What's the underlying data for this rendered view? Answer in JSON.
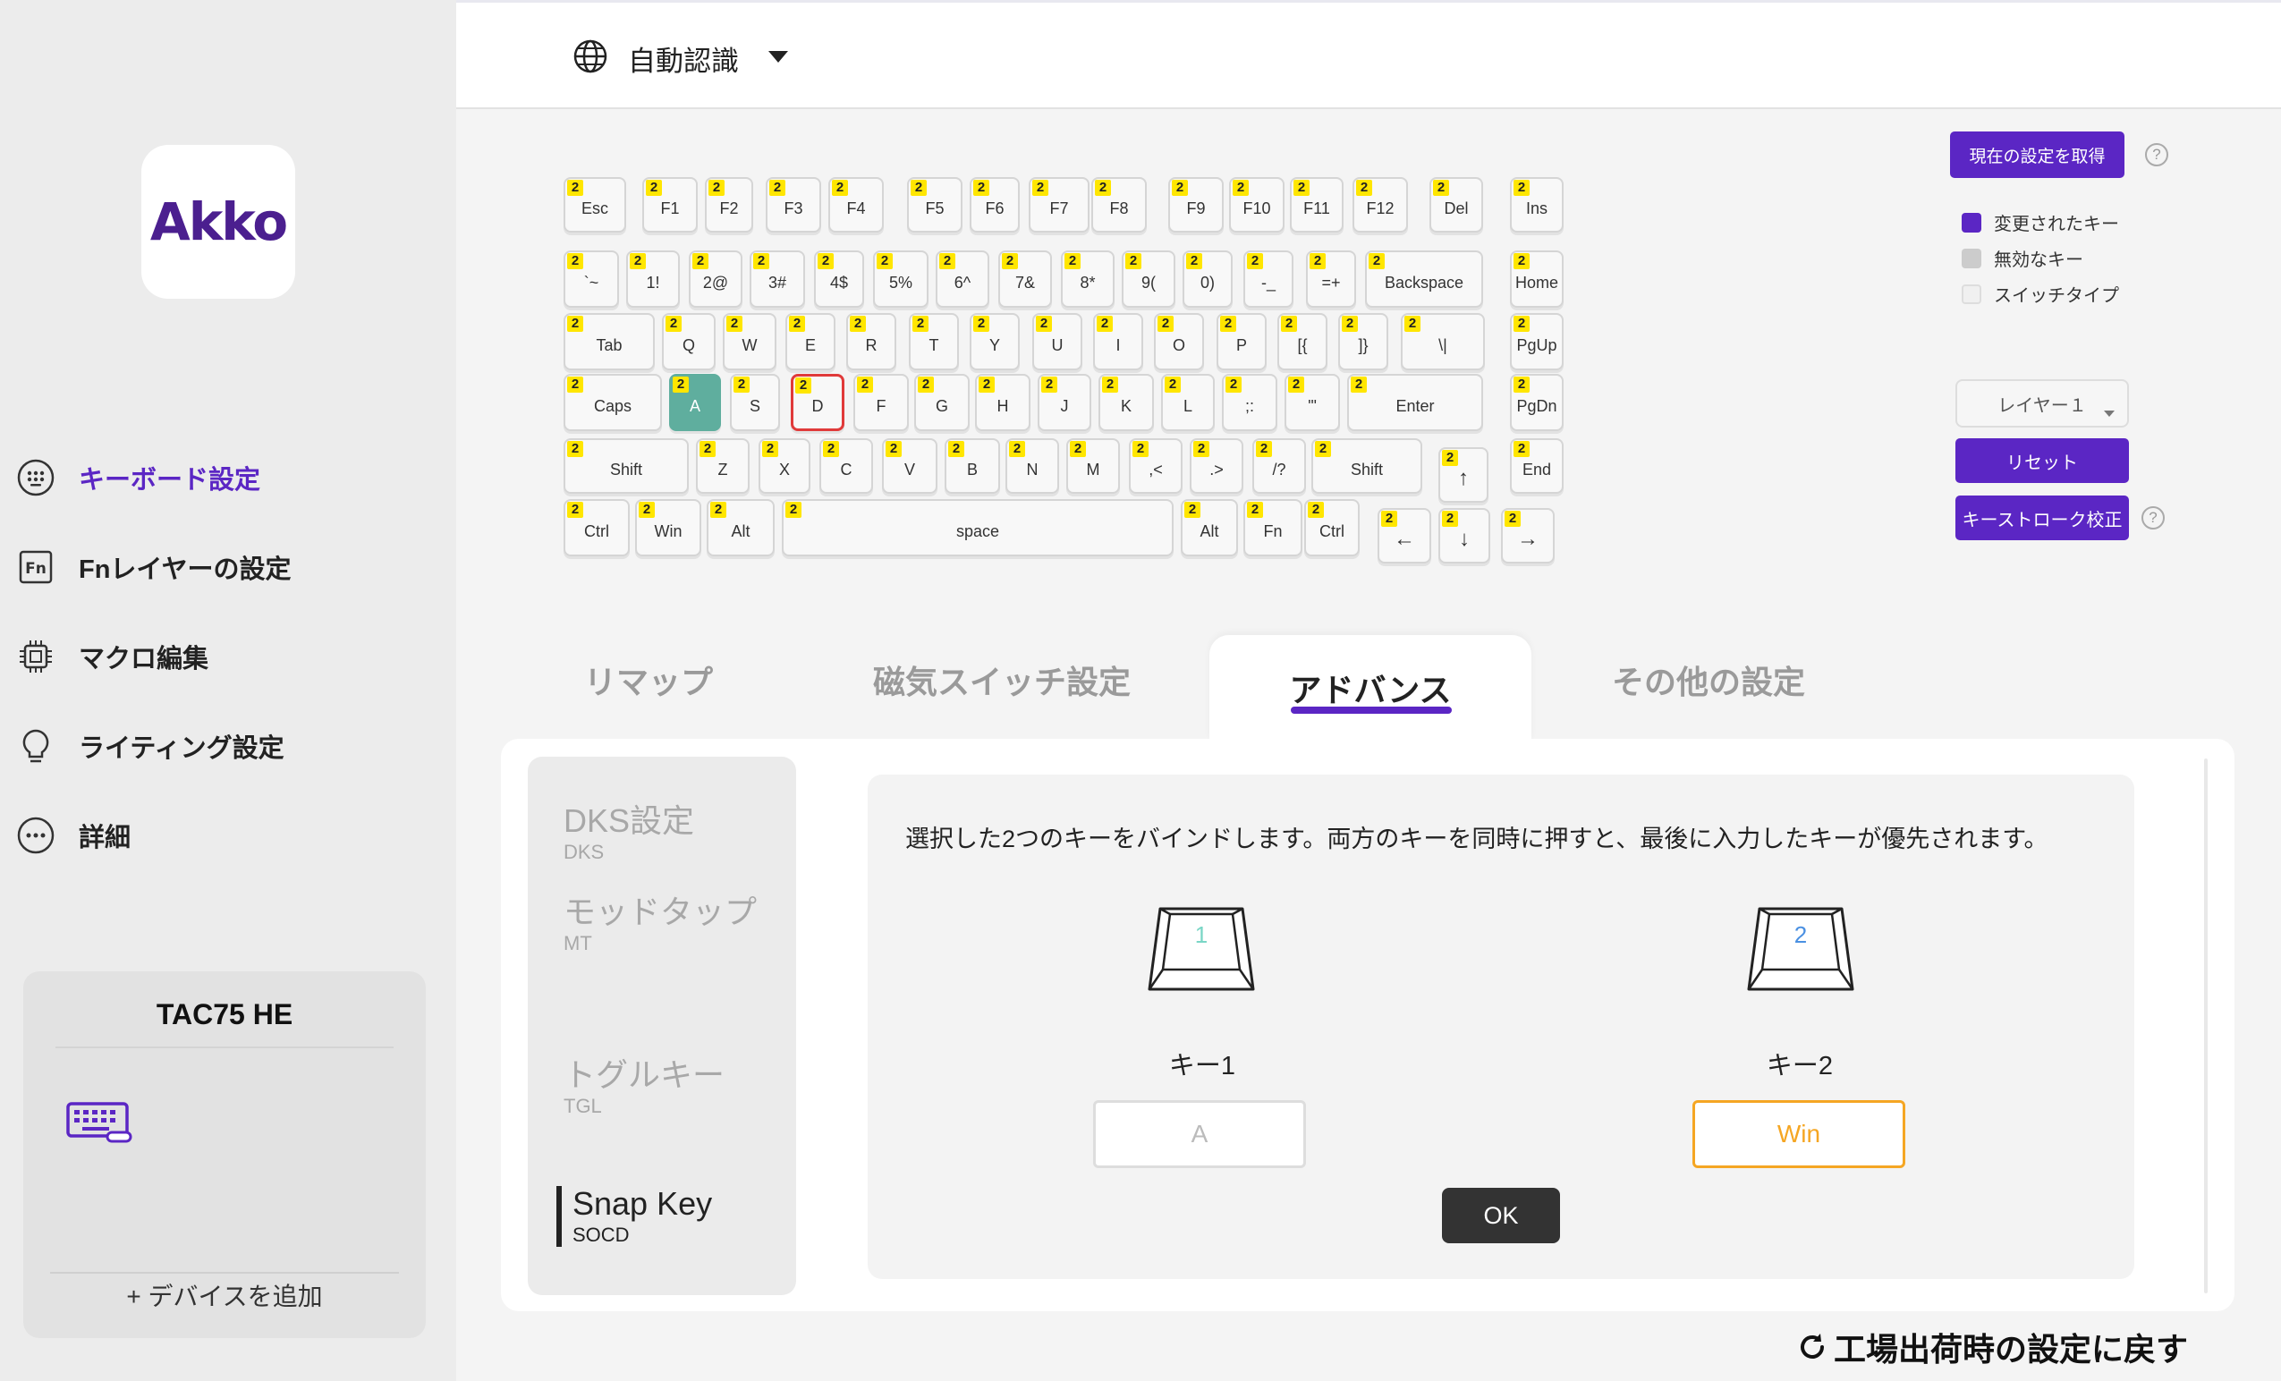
{
  "header": {
    "language_label": "自動認識"
  },
  "sidebar": {
    "logo_text": "Akko",
    "nav": [
      {
        "label": "キーボード設定",
        "icon": "keypad-icon",
        "active": true
      },
      {
        "label": "Fnレイヤーの設定",
        "icon": "fn-icon",
        "active": false
      },
      {
        "label": "マクロ編集",
        "icon": "chip-icon",
        "active": false
      },
      {
        "label": "ライティング設定",
        "icon": "bulb-icon",
        "active": false
      },
      {
        "label": "詳細",
        "icon": "more-icon",
        "active": false
      }
    ],
    "device": {
      "name": "TAC75 HE",
      "add_label": "+ デバイスを追加"
    }
  },
  "keyboard": {
    "badge": "2",
    "rows": [
      [
        [
          "Esc",
          "esc"
        ],
        [
          "F1",
          "f1"
        ],
        [
          "F2",
          "f2"
        ],
        [
          "F3",
          "f3"
        ],
        [
          "F4",
          "f4"
        ],
        [
          "F5",
          "f5"
        ],
        [
          "F6",
          "f6"
        ],
        [
          "F7",
          "f7"
        ],
        [
          "F8",
          "f8"
        ],
        [
          "F9",
          "f9"
        ],
        [
          "F10",
          "f10"
        ],
        [
          "F11",
          "f11"
        ],
        [
          "F12",
          "f12"
        ],
        [
          "Del",
          "del"
        ],
        [
          "Ins",
          "ins"
        ]
      ],
      [
        [
          "`~",
          "backtick"
        ],
        [
          "1!",
          "1"
        ],
        [
          "2@",
          "2"
        ],
        [
          "3#",
          "3"
        ],
        [
          "4$",
          "4"
        ],
        [
          "5%",
          "5"
        ],
        [
          "6^",
          "6"
        ],
        [
          "7&",
          "7"
        ],
        [
          "8*",
          "8"
        ],
        [
          "9(",
          "9"
        ],
        [
          "0)",
          "0"
        ],
        [
          "-_",
          "minus"
        ],
        [
          "=+",
          "equal"
        ],
        [
          "Backspace",
          "backspace"
        ],
        [
          "Home",
          "home"
        ]
      ],
      [
        [
          "Tab",
          "tab"
        ],
        [
          "Q",
          "q"
        ],
        [
          "W",
          "w"
        ],
        [
          "E",
          "e"
        ],
        [
          "R",
          "r"
        ],
        [
          "T",
          "t"
        ],
        [
          "Y",
          "y"
        ],
        [
          "U",
          "u"
        ],
        [
          "I",
          "i"
        ],
        [
          "O",
          "o"
        ],
        [
          "P",
          "p"
        ],
        [
          "[{",
          "lbracket"
        ],
        [
          "]}",
          "rbracket"
        ],
        [
          "\\|",
          "backslash"
        ],
        [
          "PgUp",
          "pgup"
        ]
      ],
      [
        [
          "Caps",
          "caps"
        ],
        [
          "A",
          "a"
        ],
        [
          "S",
          "s"
        ],
        [
          "D",
          "d"
        ],
        [
          "F",
          "f"
        ],
        [
          "G",
          "g"
        ],
        [
          "H",
          "h"
        ],
        [
          "J",
          "j"
        ],
        [
          "K",
          "k"
        ],
        [
          "L",
          "l"
        ],
        [
          ";:",
          "semicolon"
        ],
        [
          "'\"",
          "quote"
        ],
        [
          "Enter",
          "enter"
        ],
        [
          "PgDn",
          "pgdn"
        ]
      ],
      [
        [
          "Shift",
          "lshift"
        ],
        [
          "Z",
          "z"
        ],
        [
          "X",
          "x"
        ],
        [
          "C",
          "c"
        ],
        [
          "V",
          "v"
        ],
        [
          "B",
          "b"
        ],
        [
          "N",
          "n"
        ],
        [
          "M",
          "m"
        ],
        [
          ",<",
          "comma"
        ],
        [
          ".>",
          "period"
        ],
        [
          "/?",
          "slash"
        ],
        [
          "Shift",
          "rshift"
        ],
        [
          "↑",
          "up"
        ],
        [
          "End",
          "end"
        ]
      ],
      [
        [
          "Ctrl",
          "lctrl"
        ],
        [
          "Win",
          "lwin"
        ],
        [
          "Alt",
          "lalt"
        ],
        [
          "space",
          "space"
        ],
        [
          "Alt",
          "ralt"
        ],
        [
          "Fn",
          "fn"
        ],
        [
          "Ctrl",
          "rctrl"
        ],
        [
          "←",
          "left"
        ],
        [
          "↓",
          "down"
        ],
        [
          "→",
          "right"
        ]
      ]
    ],
    "changed_key": "a",
    "selected_key": "d"
  },
  "controls": {
    "fetch_button": "現在の設定を取得",
    "legend": [
      {
        "label": "変更されたキー",
        "color": "#5b26c4"
      },
      {
        "label": "無効なキー",
        "color": "#cccccc"
      },
      {
        "label": "スイッチタイプ",
        "color": "#f0f0f0"
      }
    ],
    "layer": "レイヤー１",
    "reset_button": "リセット",
    "calibrate_button": "キーストローク校正"
  },
  "tabs": [
    {
      "label": "リマップ",
      "active": false
    },
    {
      "label": "磁気スイッチ設定",
      "active": false
    },
    {
      "label": "アドバンス",
      "active": true
    },
    {
      "label": "その他の設定",
      "active": false
    }
  ],
  "advanced": {
    "subnav": [
      {
        "title": "DKS設定",
        "code": "DKS",
        "active": false
      },
      {
        "title": "モッドタップ",
        "code": "MT",
        "active": false
      },
      {
        "title": "トグルキー",
        "code": "TGL",
        "active": false
      },
      {
        "title": "Snap Key",
        "code": "SOCD",
        "active": true
      }
    ],
    "description": "選択した2つのキーをバインドします。両方のキーを同時に押すと、最後に入力したキーが優先されます。",
    "key1": {
      "number": "1",
      "label": "キー1",
      "value": "A"
    },
    "key2": {
      "number": "2",
      "label": "キー2",
      "value": "Win"
    },
    "ok_button": "OK"
  },
  "footer": {
    "factory_reset": "工場出荷時の設定に戻す"
  },
  "colors": {
    "accent": "#5b26c4",
    "changed_key": "#5fae9e",
    "selected_border": "#e03a3a",
    "badge": "#ffe600",
    "key2_highlight": "#f5a623"
  }
}
